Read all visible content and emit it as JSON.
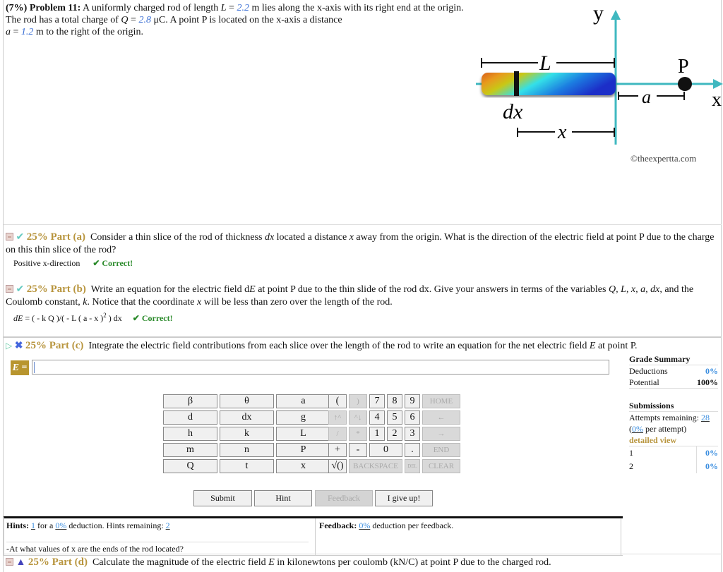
{
  "problem": {
    "weight": "(7%)",
    "label": "Problem 11:",
    "text1": "A uniformly charged rod of length",
    "L_sym": "L",
    "eq": " = ",
    "L_val": "2.2",
    "text2": " m lies along the x-axis with its right end at the origin. The rod has a total charge of ",
    "Q_sym": "Q",
    "Q_val": "2.8",
    "text3": " μC. A point P is located on the x-axis a distance ",
    "a_sym": "a",
    "a_val": "1.2",
    "text4": " m to the right of the origin."
  },
  "diagram": {
    "y_label": "y",
    "x_label": "x",
    "L_label": "L",
    "P_label": "P",
    "a_label": "a",
    "dx_label": "dx",
    "xdist_label": "x",
    "copyright": "©theexpertta.com",
    "colors": {
      "axis": "#3fb8c0",
      "rod_start": "#e07a1a",
      "rod_mid": "#33e0e8",
      "rod_end": "#1a2ec8"
    }
  },
  "parts": {
    "a": {
      "title": "25% Part (a)",
      "q1": "Consider a thin slice of the rod of thickness ",
      "dx": "dx",
      "q2": " located a distance ",
      "x": "x",
      "q3": " away from the origin. What is the direction of the electric field at point P due to the charge on this thin slice of the rod?",
      "answer": "Positive x-direction",
      "status": "✔ Correct!"
    },
    "b": {
      "title": "25% Part (b)",
      "q1": "Write an equation for the electric field d",
      "E": "E",
      "q2": " at point P due to the thin slide of the rod dx. Give your answers in terms of the variables ",
      "vars": "Q, L, x, a, dx",
      "q3": ", and the Coulomb constant, ",
      "k": "k",
      "q4": ". Notice that the coordinate ",
      "x": "x",
      "q5": " will be less than zero over the length of the rod.",
      "answer_lhs": "dE",
      "answer_rhs": " = ( - k Q )/( - L ( a - x )",
      "answer_exp": "2",
      "answer_tail": " ) dx",
      "status": "✔ Correct!"
    },
    "c": {
      "title": "25% Part (c)",
      "q1": "Integrate the electric field contributions from each slice over the length of the rod to write an equation for the net electric field ",
      "E": "E",
      "q2": " at point P.",
      "input_label": "E =",
      "input_value": ""
    },
    "d": {
      "title": "25% Part (d)",
      "q1": "Calculate the magnitude of the electric field ",
      "E": "E",
      "q2": " in kilonewtons per coulomb (kN/C) at point P due to the charged rod."
    }
  },
  "grade_summary": {
    "title": "Grade Summary",
    "deductions_label": "Deductions",
    "deductions_value": "0%",
    "potential_label": "Potential",
    "potential_value": "100%",
    "submissions_title": "Submissions",
    "attempts_label": "Attempts remaining: ",
    "attempts_value": "28",
    "per_attempt_open": "(",
    "per_attempt_value": "0%",
    "per_attempt_close": " per attempt)",
    "detailed_view": "detailed view",
    "submissions": [
      {
        "n": "1",
        "value": "0%"
      },
      {
        "n": "2",
        "value": "0%"
      }
    ]
  },
  "keypad": {
    "vars": [
      [
        "β",
        "θ",
        "a"
      ],
      [
        "d",
        "dx",
        "g"
      ],
      [
        "h",
        "k",
        "L"
      ],
      [
        "m",
        "n",
        "P"
      ],
      [
        "Q",
        "t",
        "x"
      ]
    ],
    "ops": {
      "lparen": "(",
      "rparen": ")",
      "seven": "7",
      "eight": "8",
      "nine": "9",
      "home": "HOME",
      "up": "↑^",
      "down": "^↓",
      "four": "4",
      "five": "5",
      "six": "6",
      "left": "←",
      "div": "/",
      "mul": "*",
      "one": "1",
      "two": "2",
      "three": "3",
      "right": "→",
      "plus": "+",
      "minus": "-",
      "zero": "0",
      "dot": ".",
      "end": "END",
      "sqrt": "√()",
      "backspace": "BACKSPACE",
      "del": "DEL",
      "clear": "CLEAR"
    }
  },
  "buttons": {
    "submit": "Submit",
    "hint": "Hint",
    "feedback": "Feedback",
    "give_up": "I give up!"
  },
  "hints": {
    "label": "Hints:",
    "count": "1",
    "for_a": " for a ",
    "deduction": "0%",
    "text": " deduction. Hints remaining: ",
    "remaining": "2",
    "hint_text": "-At what values of x are the ends of the rod located?"
  },
  "feedback": {
    "label": "Feedback:",
    "value": "0%",
    "text": " deduction per feedback."
  }
}
